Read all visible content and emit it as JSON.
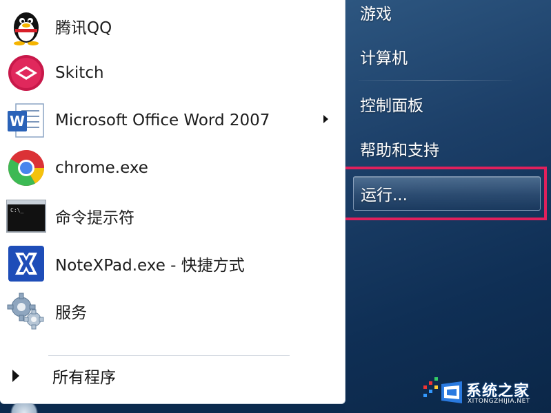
{
  "left_pane": {
    "programs": [
      {
        "label": "腾讯QQ",
        "icon": "qq-penguin-icon"
      },
      {
        "label": "Skitch",
        "icon": "skitch-icon"
      },
      {
        "label": "Microsoft Office Word 2007",
        "icon": "word-icon",
        "has_submenu": true
      },
      {
        "label": "chrome.exe",
        "icon": "chrome-icon"
      },
      {
        "label": "命令提示符",
        "icon": "command-prompt-icon"
      },
      {
        "label": "NoteXPad.exe - 快捷方式",
        "icon": "notexpad-icon"
      },
      {
        "label": "服务",
        "icon": "services-gear-icon"
      }
    ],
    "all_programs_label": "所有程序"
  },
  "right_pane": {
    "items": [
      {
        "label": "游戏"
      },
      {
        "label": "计算机"
      },
      {
        "label": "控制面板"
      },
      {
        "label": "帮助和支持"
      },
      {
        "label": "运行..."
      }
    ],
    "highlighted_item": "运行..."
  },
  "watermark": {
    "text": "系统之家",
    "url": "XITONGZHIJIA.NET"
  },
  "colors": {
    "highlight_border": "#e0205c",
    "right_pane_bg": "#1c3f68"
  }
}
